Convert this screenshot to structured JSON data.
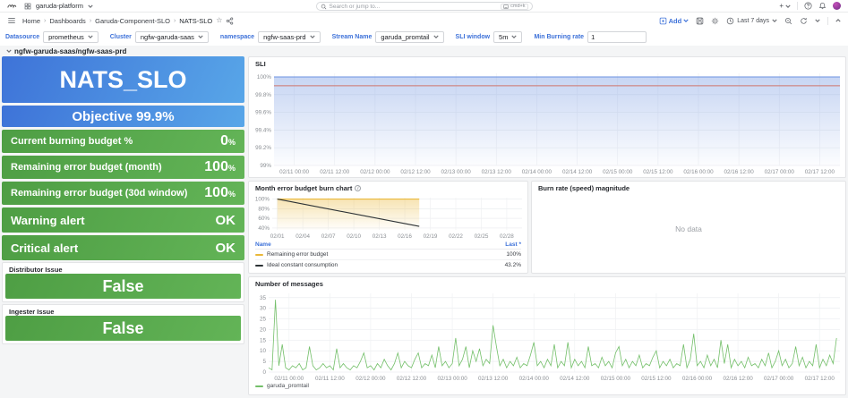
{
  "topnav": {
    "org": "garuda-platform",
    "search_placeholder": "Search or jump to...",
    "search_shortcut": "cmd+k",
    "new_button": "+"
  },
  "breadcrumb": {
    "sep": "›",
    "items": [
      "Home",
      "Dashboards",
      "Garuda-Component-SLO",
      "NATS-SLO"
    ]
  },
  "toolbar": {
    "add_label": "Add",
    "time_range": "Last 7 days"
  },
  "filters": [
    {
      "label": "Datasource",
      "value": "prometheus",
      "type": "dropdown"
    },
    {
      "label": "Cluster",
      "value": "ngfw-garuda-saas",
      "type": "dropdown"
    },
    {
      "label": "namespace",
      "value": "ngfw-saas-prd",
      "type": "dropdown"
    },
    {
      "label": "Stream Name",
      "value": "garuda_promtail",
      "type": "dropdown"
    },
    {
      "label": "SLI window",
      "value": "5m",
      "type": "dropdown"
    },
    {
      "label": "Min Burning rate",
      "value": "1",
      "type": "input"
    }
  ],
  "row": {
    "title": "ngfw-garuda-saas/ngfw-saas-prd"
  },
  "stats": {
    "nats": {
      "label": "NATS_SLO"
    },
    "objective": {
      "label": "Objective 99.9%"
    },
    "rows": [
      {
        "label": "Current burning budget %",
        "value": "0",
        "suffix": "%"
      },
      {
        "label": "Remaining error budget (month)",
        "value": "100",
        "suffix": "%"
      },
      {
        "label": "Remaining error budget (30d window)",
        "value": "100",
        "suffix": "%"
      },
      {
        "label": "Warning alert",
        "value": "OK",
        "suffix": ""
      },
      {
        "label": "Critical alert",
        "value": "OK",
        "suffix": ""
      }
    ],
    "bool_panels": [
      {
        "title": "Distributor Issue",
        "value": "False"
      },
      {
        "title": "Ingester Issue",
        "value": "False"
      }
    ]
  },
  "panels": {
    "burn_rate": {
      "title": "Burn rate (speed) magnitude",
      "no_data": "No data"
    }
  },
  "colors": {
    "accent_blue": "#3d71d9",
    "stat_blue_a": "#3e73d8",
    "stat_blue_b": "#58a6e8",
    "stat_green_a": "#4e9e44",
    "stat_green_b": "#63b457",
    "sli_line": "#6c92e0",
    "objective_line": "#d0756b",
    "budget_yellow": "#eab839",
    "ideal_line": "#2c3235",
    "messages_green": "#73bf69"
  },
  "chart_data": [
    {
      "id": "sli",
      "type": "line",
      "title": "SLI",
      "x_range": [
        0,
        168
      ],
      "y_range": [
        99,
        100.04
      ],
      "grid": true,
      "legend_position": "none",
      "y_ticks": [
        {
          "v": 99,
          "label": "99%"
        },
        {
          "v": 99.2,
          "label": "99.2%"
        },
        {
          "v": 99.4,
          "label": "99.4%"
        },
        {
          "v": 99.6,
          "label": "99.6%"
        },
        {
          "v": 99.8,
          "label": "99.8%"
        },
        {
          "v": 100,
          "label": "100%"
        }
      ],
      "x_ticks": [
        {
          "v": 6,
          "label": "02/11 00:00"
        },
        {
          "v": 18,
          "label": "02/11 12:00"
        },
        {
          "v": 30,
          "label": "02/12 00:00"
        },
        {
          "v": 42,
          "label": "02/12 12:00"
        },
        {
          "v": 54,
          "label": "02/13 00:00"
        },
        {
          "v": 66,
          "label": "02/13 12:00"
        },
        {
          "v": 78,
          "label": "02/14 00:00"
        },
        {
          "v": 90,
          "label": "02/14 12:00"
        },
        {
          "v": 102,
          "label": "02/15 00:00"
        },
        {
          "v": 114,
          "label": "02/15 12:00"
        },
        {
          "v": 126,
          "label": "02/16 00:00"
        },
        {
          "v": 138,
          "label": "02/16 12:00"
        },
        {
          "v": 150,
          "label": "02/17 00:00"
        },
        {
          "v": 162,
          "label": "02/17 12:00"
        }
      ],
      "threshold": {
        "v": 99.9,
        "color": "#d0756b",
        "label": "objective 99.9%"
      },
      "series": [
        {
          "name": "SLI",
          "color": "#6c92e0",
          "fill": true,
          "points": [
            [
              0,
              100
            ],
            [
              168,
              100
            ]
          ]
        }
      ]
    },
    {
      "id": "burn",
      "type": "line",
      "title": "Month error budget burn chart",
      "x_range": [
        0.4,
        29.8
      ],
      "y_range": [
        36,
        103
      ],
      "grid": true,
      "legend_position": "bottom-table",
      "legend": {
        "name_header": "Name",
        "last_header": "Last *"
      },
      "y_ticks": [
        {
          "v": 40,
          "label": "40%"
        },
        {
          "v": 60,
          "label": "60%"
        },
        {
          "v": 80,
          "label": "80%"
        },
        {
          "v": 100,
          "label": "100%"
        }
      ],
      "x_ticks": [
        {
          "v": 1,
          "label": "02/01"
        },
        {
          "v": 4,
          "label": "02/04"
        },
        {
          "v": 7,
          "label": "02/07"
        },
        {
          "v": 10,
          "label": "02/10"
        },
        {
          "v": 13,
          "label": "02/13"
        },
        {
          "v": 16,
          "label": "02/16"
        },
        {
          "v": 19,
          "label": "02/19"
        },
        {
          "v": 22,
          "label": "02/22"
        },
        {
          "v": 25,
          "label": "02/25"
        },
        {
          "v": 28,
          "label": "02/28"
        }
      ],
      "series": [
        {
          "name": "Remaining error budget",
          "color": "#eab839",
          "fill": true,
          "last": "100%",
          "points": [
            [
              1,
              100
            ],
            [
              17.7,
              100
            ]
          ]
        },
        {
          "name": "Ideal constant consumption",
          "color": "#2c3235",
          "last": "43.2%",
          "points": [
            [
              1,
              100
            ],
            [
              17.7,
              43.2
            ]
          ]
        }
      ]
    },
    {
      "id": "messages",
      "type": "line",
      "title": "Number of messages",
      "x_range": [
        0,
        168
      ],
      "y_range": [
        0,
        37
      ],
      "grid": true,
      "legend_position": "bottom",
      "y_ticks": [
        {
          "v": 0,
          "label": "0"
        },
        {
          "v": 5,
          "label": "5"
        },
        {
          "v": 10,
          "label": "10"
        },
        {
          "v": 15,
          "label": "15"
        },
        {
          "v": 20,
          "label": "20"
        },
        {
          "v": 25,
          "label": "25"
        },
        {
          "v": 30,
          "label": "30"
        },
        {
          "v": 35,
          "label": "35"
        }
      ],
      "x_ticks": [
        {
          "v": 6,
          "label": "02/11 00:00"
        },
        {
          "v": 18,
          "label": "02/11 12:00"
        },
        {
          "v": 30,
          "label": "02/12 00:00"
        },
        {
          "v": 42,
          "label": "02/12 12:00"
        },
        {
          "v": 54,
          "label": "02/13 00:00"
        },
        {
          "v": 66,
          "label": "02/13 12:00"
        },
        {
          "v": 78,
          "label": "02/14 00:00"
        },
        {
          "v": 90,
          "label": "02/14 12:00"
        },
        {
          "v": 102,
          "label": "02/15 00:00"
        },
        {
          "v": 114,
          "label": "02/15 12:00"
        },
        {
          "v": 126,
          "label": "02/16 00:00"
        },
        {
          "v": 138,
          "label": "02/16 12:00"
        },
        {
          "v": 150,
          "label": "02/17 00:00"
        },
        {
          "v": 162,
          "label": "02/17 12:00"
        }
      ],
      "series": [
        {
          "name": "garuda_promtail",
          "color": "#73bf69",
          "x_step": 1,
          "values": [
            2,
            1,
            34,
            3,
            13,
            2,
            1,
            3,
            2,
            4,
            1,
            2,
            12,
            3,
            1,
            2,
            4,
            2,
            3,
            1,
            11,
            2,
            4,
            2,
            1,
            3,
            2,
            5,
            9,
            2,
            3,
            1,
            4,
            2,
            6,
            3,
            1,
            4,
            9,
            2,
            5,
            3,
            2,
            6,
            9,
            2,
            4,
            3,
            8,
            2,
            12,
            3,
            5,
            2,
            4,
            16,
            3,
            6,
            12,
            2,
            10,
            5,
            11,
            3,
            6,
            4,
            22,
            12,
            3,
            6,
            2,
            5,
            3,
            7,
            2,
            4,
            3,
            8,
            14,
            3,
            5,
            2,
            6,
            3,
            13,
            2,
            5,
            3,
            14,
            2,
            6,
            3,
            5,
            2,
            12,
            3,
            4,
            2,
            7,
            3,
            5,
            2,
            9,
            12,
            3,
            6,
            2,
            5,
            3,
            8,
            2,
            4,
            3,
            7,
            10,
            2,
            5,
            3,
            6,
            2,
            4,
            3,
            13,
            2,
            6,
            18,
            3,
            5,
            2,
            8,
            3,
            6,
            2,
            15,
            4,
            13,
            2,
            6,
            3,
            5,
            2,
            7,
            3,
            4,
            2,
            6,
            3,
            9,
            2,
            5,
            10,
            3,
            6,
            2,
            4,
            12,
            3,
            7,
            2,
            5,
            3,
            13,
            2,
            6,
            3,
            8,
            4,
            16
          ]
        }
      ]
    }
  ]
}
